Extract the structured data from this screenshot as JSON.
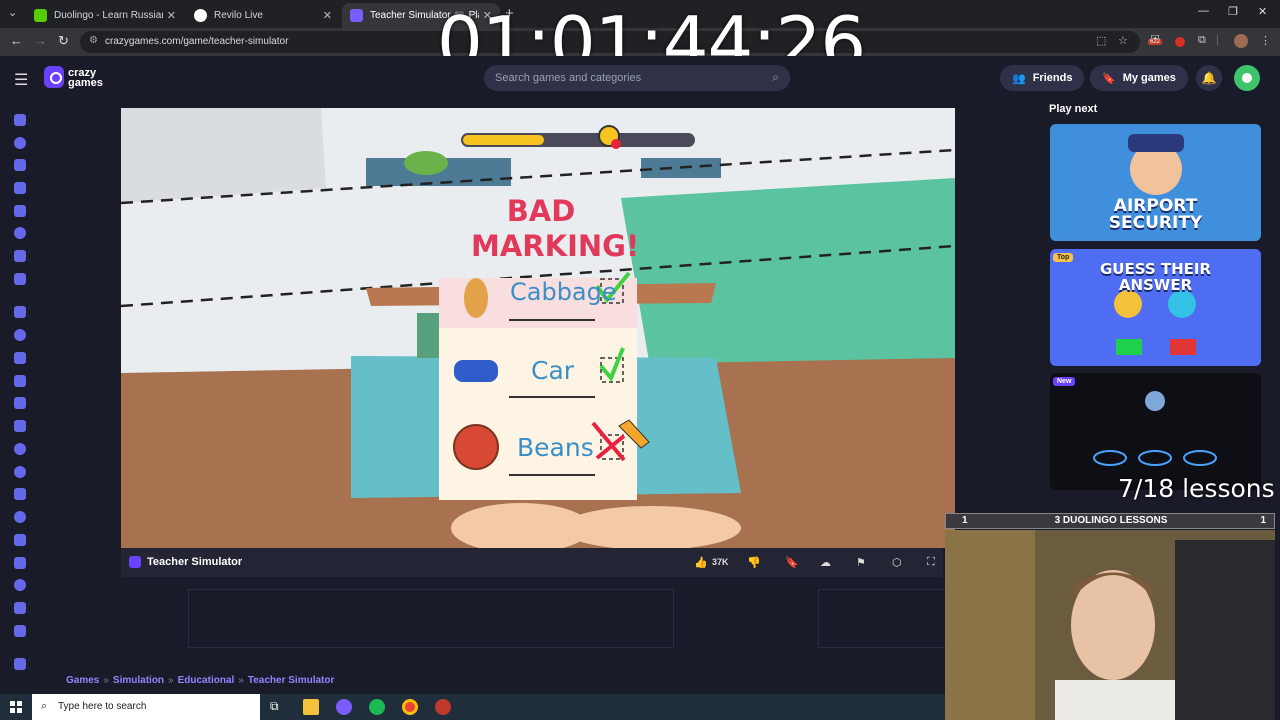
{
  "browser": {
    "tabs": [
      {
        "title": "Duolingo - Learn Russian with Ja",
        "favicon_color": "#58cc02"
      },
      {
        "title": "Revilo Live",
        "favicon_color": "#ffffff"
      },
      {
        "title": "Teacher Simulator 🎮 Play",
        "favicon_color": "#7b5cff"
      }
    ],
    "url": "crazygames.com/game/teacher-simulator",
    "extension_badge": "622"
  },
  "overlay": {
    "timer": "01:01:44:26",
    "lessons_progress": "7/18 lessons",
    "lesson_bar": {
      "left": "1",
      "center": "3 DUOLINGO LESSONS",
      "right": "1"
    }
  },
  "site": {
    "logo_line1": "crazy",
    "logo_line2": "games",
    "search_placeholder": "Search games and categories",
    "friends_label": "Friends",
    "mygames_label": "My games"
  },
  "game": {
    "title": "Teacher Simulator",
    "likes": "37K",
    "banner_line1": "BAD",
    "banner_line2": "MARKING!",
    "words": [
      "Cabbage",
      "Car",
      "Beans"
    ],
    "progress": 0.35,
    "colors": {
      "accent": "#6842ff",
      "banner": "#e0395a",
      "ink": "#3a8fc8",
      "check": "#3ed33e",
      "cross": "#e8213c"
    }
  },
  "play_next": {
    "title": "Play next",
    "cards": [
      {
        "label_line1": "AIRPORT",
        "label_line2": "SECURITY",
        "tag": ""
      },
      {
        "label_line1": "GUESS THEIR",
        "label_line2": "ANSWER",
        "tag": "Top"
      },
      {
        "label_line1": "",
        "label_line2": "",
        "tag": "New"
      }
    ]
  },
  "breadcrumb": [
    "Games",
    "Simulation",
    "Educational",
    "Teacher Simulator"
  ],
  "taskbar": {
    "search_placeholder": "Type here to search"
  }
}
